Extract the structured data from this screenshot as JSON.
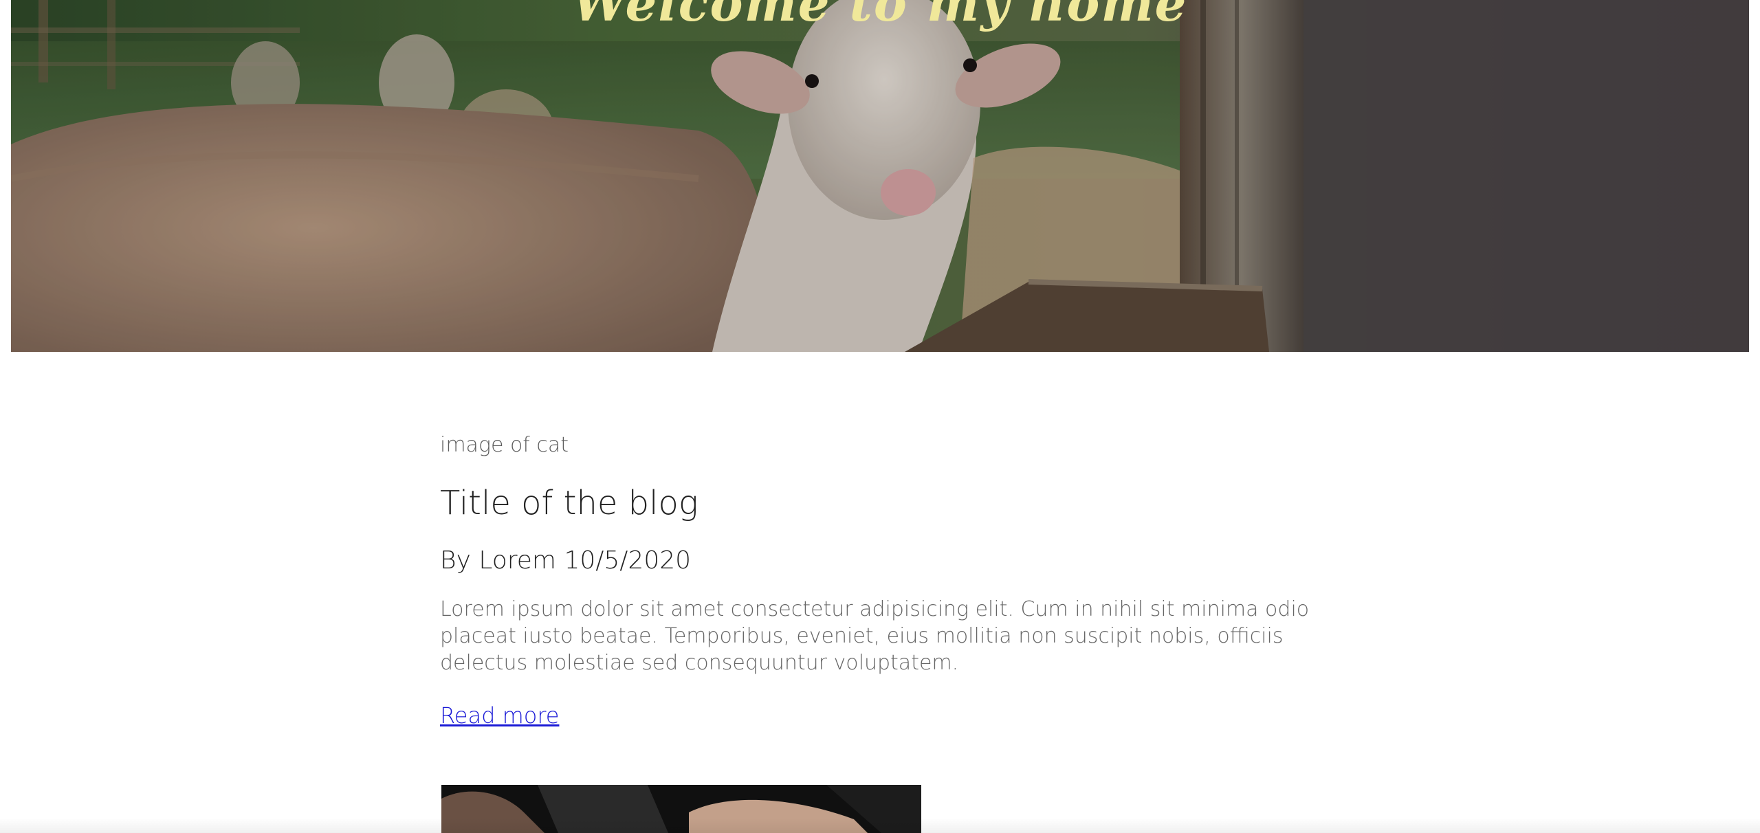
{
  "hero": {
    "title": "Welcome to my home"
  },
  "post": {
    "image_alt": "image of cat",
    "title": "Title of the blog",
    "byline": "By Lorem 10/5/2020",
    "excerpt": "Lorem ipsum dolor sit amet consectetur adipisicing elit. Cum in nihil sit minima odio placeat iusto beatae. Temporibus, eveniet, eius mollitia non suscipit nobis, officiis delectus molestiae sed consequuntur voluptatem.",
    "read_more": "Read more"
  },
  "colors": {
    "hero_title": "#f0e89a",
    "link": "#1a1ad6"
  }
}
